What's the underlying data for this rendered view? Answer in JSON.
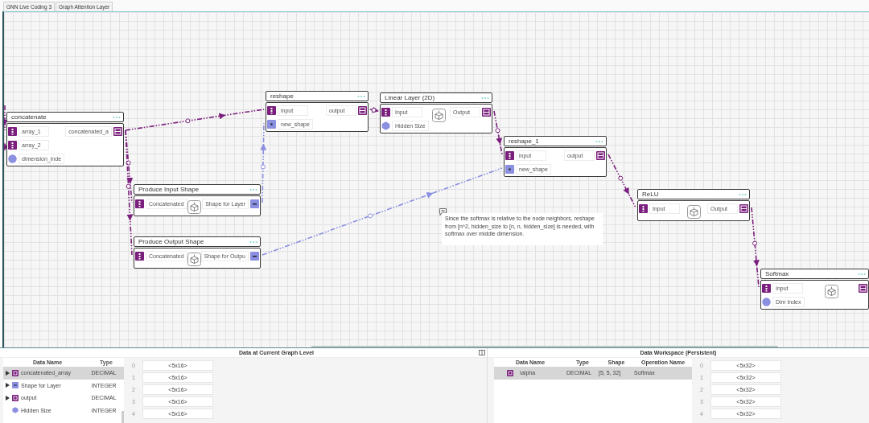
{
  "breadcrumbs": [
    {
      "label": "GNN Live Coding 3"
    },
    {
      "label": "Graph Attention Layer"
    }
  ],
  "nodes": [
    {
      "title": "concatenate",
      "has_icon": false,
      "inputs": [
        {
          "label": "array_1",
          "kind": "tensor_in"
        },
        {
          "label": "array_2",
          "kind": "tensor_in"
        },
        {
          "label": "dimension_inde",
          "kind": "scalar"
        }
      ],
      "outputs": [
        {
          "label": "concatenated_a",
          "kind": "tensor_out"
        }
      ]
    },
    {
      "title": "reshape",
      "has_icon": false,
      "inputs": [
        {
          "label": "input",
          "kind": "tensor_in"
        },
        {
          "label": "new_shape",
          "kind": "shape"
        }
      ],
      "outputs": [
        {
          "label": "output",
          "kind": "tensor_out"
        }
      ]
    },
    {
      "title": "Linear Layer (2D)",
      "has_icon": true,
      "inputs": [
        {
          "label": "Input",
          "kind": "tensor_in"
        },
        {
          "label": "Hidden Size",
          "kind": "hex"
        }
      ],
      "outputs": [
        {
          "label": "Output",
          "kind": "tensor_out"
        }
      ]
    },
    {
      "title": "reshape_1",
      "has_icon": false,
      "inputs": [
        {
          "label": "input",
          "kind": "tensor_in"
        },
        {
          "label": "new_shape",
          "kind": "shape"
        }
      ],
      "outputs": [
        {
          "label": "output",
          "kind": "tensor_out"
        }
      ]
    },
    {
      "title": "Produce Input Shape",
      "has_icon": true,
      "inputs": [
        {
          "label": "Concatenated",
          "kind": "tensor_in"
        }
      ],
      "outputs": [
        {
          "label": "Shape for Layer",
          "kind": "shape_out"
        }
      ]
    },
    {
      "title": "Produce Output Shape",
      "has_icon": true,
      "inputs": [
        {
          "label": "Concatenated",
          "kind": "tensor_in"
        }
      ],
      "outputs": [
        {
          "label": "Shape for Outpu",
          "kind": "shape_out"
        }
      ]
    },
    {
      "title": "ReLU",
      "has_icon": true,
      "inputs": [
        {
          "label": "Input",
          "kind": "tensor_in"
        }
      ],
      "outputs": [
        {
          "label": "Output",
          "kind": "tensor_out"
        }
      ]
    },
    {
      "title": "Softmax",
      "has_icon": true,
      "inputs": [
        {
          "label": "Input",
          "kind": "tensor_in"
        },
        {
          "label": "Dim Index",
          "kind": "scalar"
        }
      ],
      "outputs": [
        {
          "kind": "tensor_out"
        }
      ]
    }
  ],
  "comment": {
    "text": "Since the softmax is relative to the node neighbors, reshape from [n^2, hidden_size to [n, n, hidden_size] is needed, with softmax over middle dimension."
  },
  "current_data": {
    "title": "Data at Current Graph Level",
    "columns": [
      "Data Name",
      "Type"
    ],
    "rows": [
      {
        "name": "concatenated_array",
        "type": "DECIMAL",
        "kind": "tensor_out",
        "expandable": true,
        "selected": true
      },
      {
        "name": "Shape for Layer",
        "type": "INTEGER",
        "kind": "shape_out",
        "expandable": true,
        "selected": false
      },
      {
        "name": "output",
        "type": "DECIMAL",
        "kind": "tensor_out",
        "expandable": true,
        "selected": false
      },
      {
        "name": "Hidden Size",
        "type": "INTEGER",
        "kind": "hex",
        "expandable": false,
        "selected": false
      }
    ],
    "values": [
      {
        "index": "0",
        "value": "<5x16>"
      },
      {
        "index": "1",
        "value": "<5x16>"
      },
      {
        "index": "2",
        "value": "<5x16>"
      },
      {
        "index": "3",
        "value": "<5x16>"
      },
      {
        "index": "4",
        "value": "<5x16>"
      }
    ]
  },
  "workspace": {
    "title": "Data Workspace (Persistent)",
    "columns": [
      "Data Name",
      "Type",
      "Shape",
      "Operation Name"
    ],
    "rows": [
      {
        "name": "\\alpha",
        "type": "DECIMAL",
        "shape": "[5, 5, 32]",
        "operation": "Softmax",
        "kind": "tensor_out",
        "selected": true
      }
    ],
    "values": [
      {
        "index": "0",
        "value": "<5x32>"
      },
      {
        "index": "1",
        "value": "<5x32>"
      },
      {
        "index": "2",
        "value": "<5x32>"
      },
      {
        "index": "3",
        "value": "<5x32>"
      },
      {
        "index": "4",
        "value": "<5x32>"
      }
    ]
  }
}
